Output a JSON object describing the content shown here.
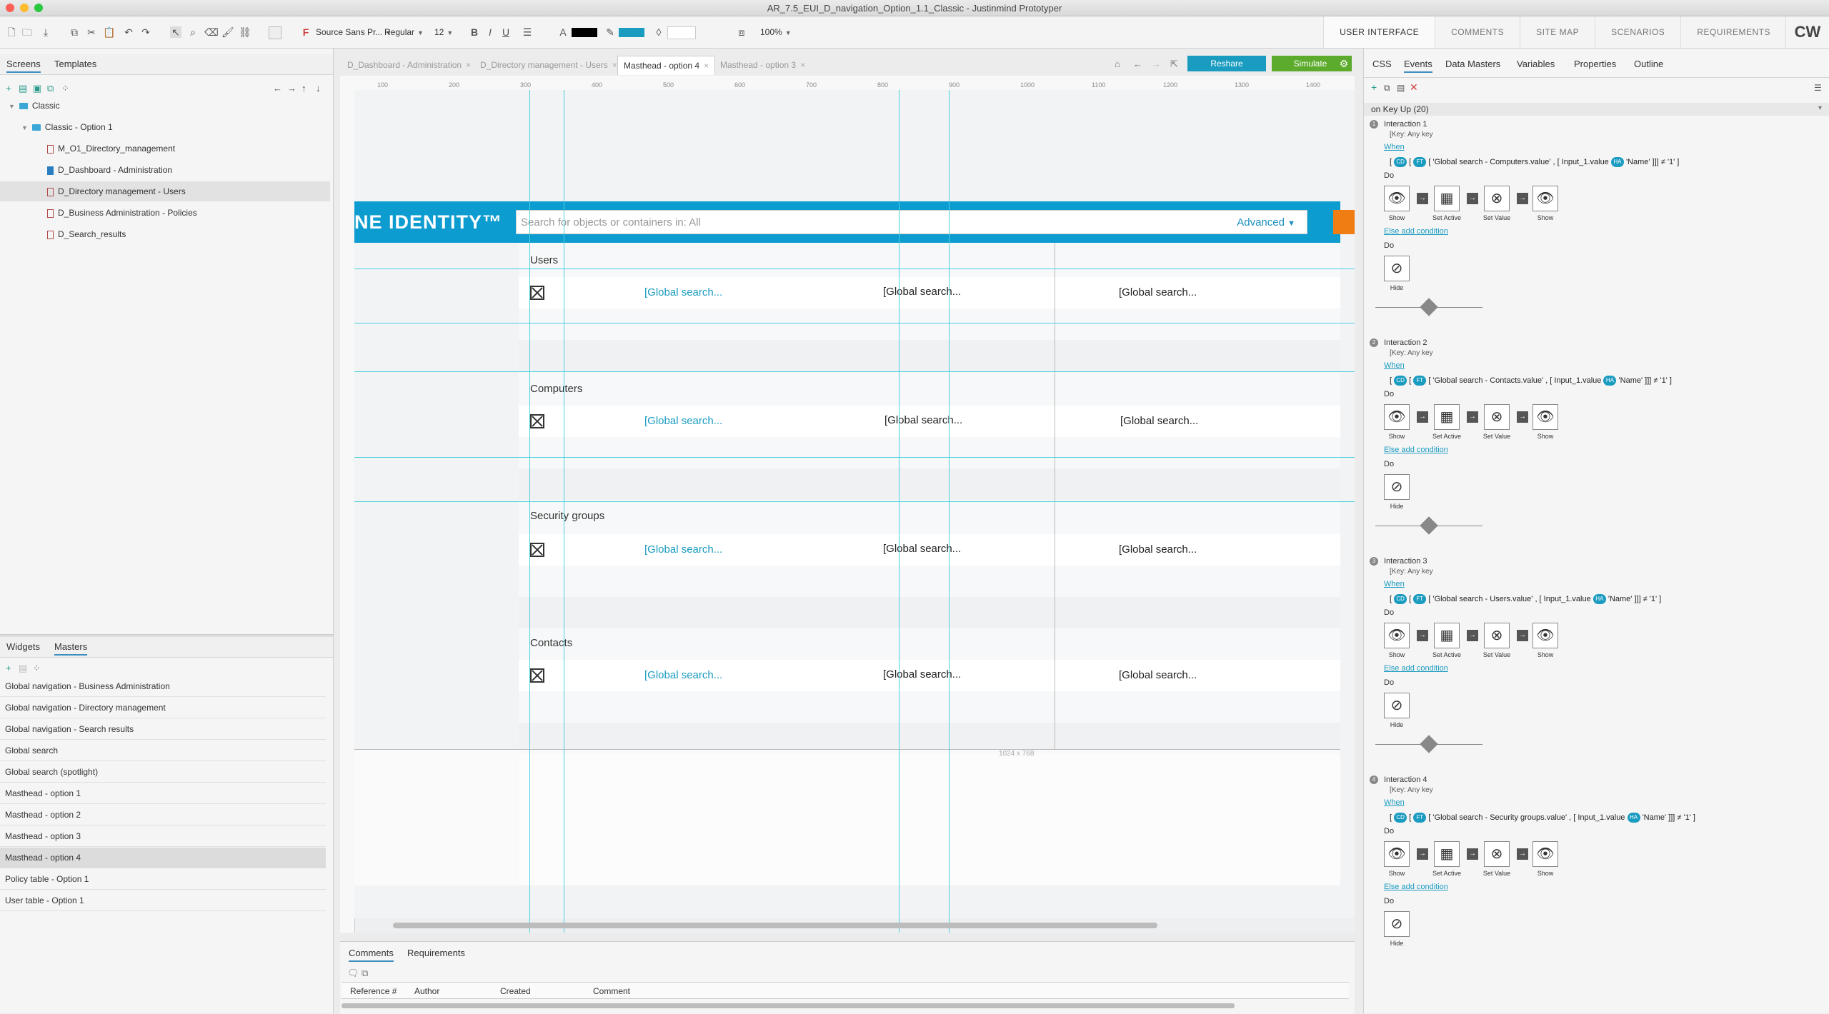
{
  "window": {
    "title": "AR_7.5_EUI_D_navigation_Option_1.1_Classic - Justinmind Prototyper"
  },
  "toolbar": {
    "font_family": "Source Sans Pr...",
    "font_weight": "Regular",
    "font_size": "12",
    "bold": "B",
    "italic": "I",
    "underline": "U",
    "zoom": "100%",
    "top_nav": [
      "USER INTERFACE",
      "COMMENTS",
      "SITE MAP",
      "SCENARIOS",
      "REQUIREMENTS"
    ],
    "user_initials": "CW"
  },
  "left_panel": {
    "tabs": [
      "Screens",
      "Templates"
    ],
    "tree": [
      {
        "label": "Classic",
        "type": "folder",
        "level": 0
      },
      {
        "label": "Classic - Option 1",
        "type": "folder",
        "level": 1
      },
      {
        "label": "M_O1_Directory_management",
        "type": "page",
        "level": 2
      },
      {
        "label": "D_Dashboard - Administration",
        "type": "page-blue",
        "level": 2
      },
      {
        "label": "D_Directory management - Users",
        "type": "page",
        "level": 2,
        "selected": true
      },
      {
        "label": "D_Business Administration - Policies",
        "type": "page",
        "level": 2
      },
      {
        "label": "D_Search_results",
        "type": "page",
        "level": 2
      }
    ],
    "bottom_tabs": [
      "Widgets",
      "Masters"
    ],
    "masters": [
      "Global navigation - Business Administration",
      "Global navigation - Directory management",
      "Global navigation - Search results",
      "Global search",
      "Global search (spotlight)",
      "Masthead - option 1",
      "Masthead - option 2",
      "Masthead - option 3",
      "Masthead - option 4",
      "Policy table - Option 1",
      "User table - Option 1"
    ],
    "selected_master": "Masthead - option 4"
  },
  "doc_tabs": [
    {
      "label": "D_Dashboard - Administration",
      "active": false
    },
    {
      "label": "D_Directory management - Users",
      "active": false
    },
    {
      "label": "Masthead - option 4",
      "active": true
    },
    {
      "label": "Masthead - option 3",
      "active": false
    }
  ],
  "actions": {
    "reshare": "Reshare",
    "simulate": "Simulate"
  },
  "ruler_ticks": [
    "100",
    "200",
    "300",
    "400",
    "500",
    "600",
    "700",
    "800",
    "900",
    "1000",
    "1100",
    "1200",
    "1300",
    "1400"
  ],
  "canvas": {
    "brand_text": "NE IDENTITY™",
    "search_placeholder": "Search for objects or containers in: All",
    "advanced_label": "Advanced",
    "page_size": "1024 x 768",
    "sections": [
      {
        "title": "Users",
        "cells": [
          "[Global search...",
          "[Global search...",
          "[Global search..."
        ]
      },
      {
        "title": "Computers",
        "cells": [
          "[Global search...",
          "[Global search...",
          "[Global search..."
        ]
      },
      {
        "title": "Security groups",
        "cells": [
          "[Global search...",
          "[Global search...",
          "[Global search..."
        ]
      },
      {
        "title": "Contacts",
        "cells": [
          "[Global search...",
          "[Global search...",
          "[Global search..."
        ]
      }
    ]
  },
  "comments_panel": {
    "tabs": [
      "Comments",
      "Requirements"
    ],
    "columns": [
      "Reference #",
      "Author",
      "Created",
      "Comment"
    ]
  },
  "right_panel": {
    "tabs": [
      "CSS",
      "Events",
      "Data Masters",
      "Variables",
      "Properties",
      "Outline"
    ],
    "active_tab": "Events",
    "event_header": "on Key Up  (20)",
    "interactions": [
      {
        "title": "Interaction 1",
        "key": "[Key:  Any key",
        "when": "When",
        "condition": "'Global search - Computers.value' ,   [  Input_1.value",
        "name": "'Name'",
        "value": "'1'"
      },
      {
        "title": "Interaction 2",
        "key": "[Key:  Any key",
        "when": "When",
        "condition": "'Global search - Contacts.value' ,   [  Input_1.value",
        "name": "'Name'",
        "value": "'1'"
      },
      {
        "title": "Interaction 3",
        "key": "[Key:  Any key",
        "when": "When",
        "condition": "'Global search - Users.value' ,   [  Input_1.value",
        "name": "'Name'",
        "value": "'1'"
      },
      {
        "title": "Interaction 4",
        "key": "[Key:  Any key",
        "when": "When",
        "condition": "'Global search - Security groups.value' ,   [  Input_1.value",
        "name": "'Name'",
        "value": "'1'"
      }
    ],
    "do_label": "Do",
    "action_labels": [
      "Show",
      "Set Active",
      "Set Value",
      "Show"
    ],
    "else_label": "Else add condition",
    "hide_label": "Hide",
    "badges": {
      "cd": "CD",
      "ft": "FT",
      "ha": "HA"
    }
  },
  "colors": {
    "brand_blue": "#0d9cd0",
    "accent_orange": "#f07d14",
    "simulate_green": "#5cab2c",
    "guide_cyan": "#4bd0e0"
  }
}
